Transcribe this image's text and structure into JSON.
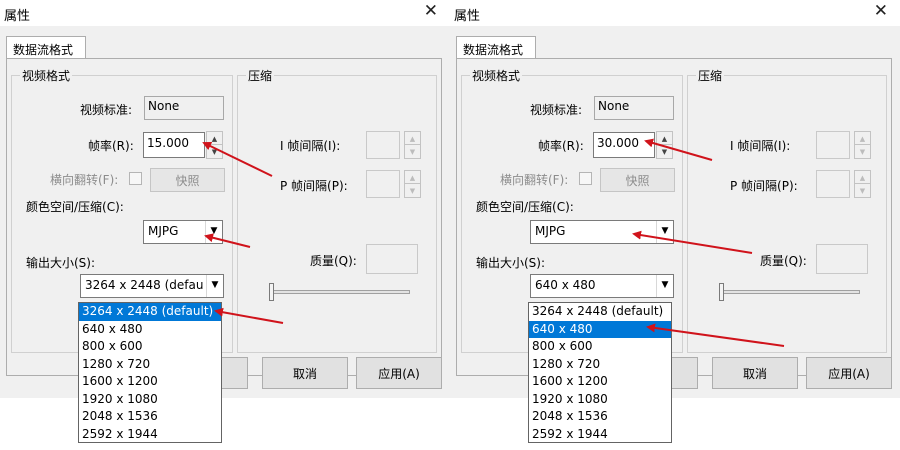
{
  "panels": [
    {
      "title": "属性",
      "close_glyph": "✕",
      "tab_label": "数据流格式",
      "video_group": "视频格式",
      "compress_group": "压缩",
      "video_standard_label": "视频标准:",
      "video_standard_value": "None",
      "frame_rate_label": "帧率(R):",
      "frame_rate_value": "15.000",
      "flip_label": "横向翻转(F):",
      "snapshot_label": "快照",
      "color_space_label": "颜色空间/压缩(C):",
      "color_space_value": "MJPG",
      "output_size_label": "输出大小(S):",
      "output_size_value": "3264 x 2448  (defau",
      "i_frame_label": "I 帧间隔(I):",
      "p_frame_label": "P 帧间隔(P):",
      "quality_label": "质量(Q):",
      "cancel_label": "取消",
      "apply_label": "应用(A)",
      "options": [
        "3264 x 2448  (default)",
        "640 x 480",
        "800 x 600",
        "1280 x 720",
        "1600 x 1200",
        "1920 x 1080",
        "2048 x 1536",
        "2592 x 1944"
      ],
      "selected_index": 0
    },
    {
      "title": "属性",
      "close_glyph": "✕",
      "tab_label": "数据流格式",
      "video_group": "视频格式",
      "compress_group": "压缩",
      "video_standard_label": "视频标准:",
      "video_standard_value": "None",
      "frame_rate_label": "帧率(R):",
      "frame_rate_value": "30.000",
      "flip_label": "横向翻转(F):",
      "snapshot_label": "快照",
      "color_space_label": "颜色空间/压缩(C):",
      "color_space_value": "MJPG",
      "output_size_label": "输出大小(S):",
      "output_size_value": "640 x 480",
      "i_frame_label": "I 帧间隔(I):",
      "p_frame_label": "P 帧间隔(P):",
      "quality_label": "质量(Q):",
      "cancel_label": "取消",
      "apply_label": "应用(A)",
      "options": [
        "3264 x 2448  (default)",
        "640 x 480",
        "800 x 600",
        "1280 x 720",
        "1600 x 1200",
        "1920 x 1080",
        "2048 x 1536",
        "2592 x 1944"
      ],
      "selected_index": 1
    }
  ],
  "colors": {
    "annotation_arrow": "#d0131b",
    "selection": "#0078d7"
  }
}
